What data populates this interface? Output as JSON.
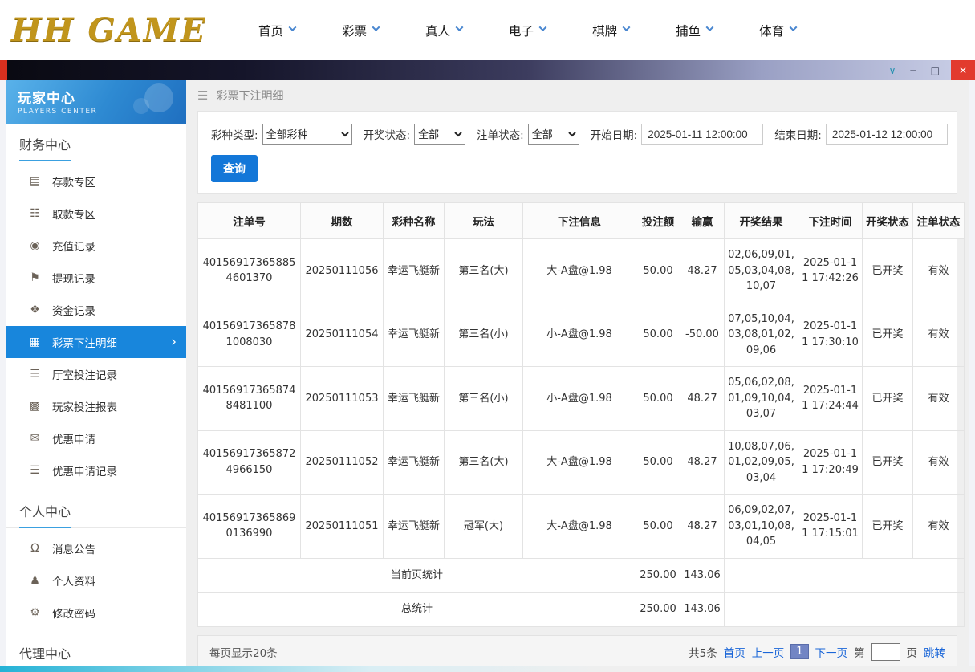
{
  "icons": {
    "menu": "☰",
    "window_chevron": "∨",
    "window_minimize": "─",
    "window_maximize": "□",
    "window_close": "✕",
    "active_arrow": "›"
  },
  "top_nav": {
    "logo": "HH GAME",
    "items": [
      "首页",
      "彩票",
      "真人",
      "电子",
      "棋牌",
      "捕鱼",
      "体育"
    ]
  },
  "sidebar": {
    "title": "玩家中心",
    "subtitle": "PLAYERS CENTER",
    "sections": [
      {
        "title": "财务中心",
        "items": [
          {
            "label": "存款专区",
            "glyph": "▤"
          },
          {
            "label": "取款专区",
            "glyph": "☷"
          },
          {
            "label": "充值记录",
            "glyph": "◉"
          },
          {
            "label": "提现记录",
            "glyph": "⚑"
          },
          {
            "label": "资金记录",
            "glyph": "❖"
          },
          {
            "label": "彩票下注明细",
            "glyph": "▦"
          },
          {
            "label": "厅室投注记录",
            "glyph": "☰"
          },
          {
            "label": "玩家投注报表",
            "glyph": "▩"
          },
          {
            "label": "优惠申请",
            "glyph": "✉"
          },
          {
            "label": "优惠申请记录",
            "glyph": "☰"
          }
        ]
      },
      {
        "title": "个人中心",
        "items": [
          {
            "label": "消息公告",
            "glyph": "Ω"
          },
          {
            "label": "个人资料",
            "glyph": "♟"
          },
          {
            "label": "修改密码",
            "glyph": "⚙"
          }
        ]
      },
      {
        "title": "代理中心",
        "items": []
      }
    ]
  },
  "breadcrumb": {
    "icon": "☰",
    "title": "彩票下注明细"
  },
  "filters": {
    "lottery_type_label": "彩种类型:",
    "lottery_type_value": "全部彩种",
    "draw_status_label": "开奖状态:",
    "draw_status_value": "全部",
    "order_status_label": "注单状态:",
    "order_status_value": "全部",
    "start_date_label": "开始日期:",
    "start_date_value": "2025-01-11 12:00:00",
    "end_date_label": "结束日期:",
    "end_date_value": "2025-01-12 12:00:00",
    "search_button": "查询"
  },
  "table": {
    "headers": [
      "注单号",
      "期数",
      "彩种名称",
      "玩法",
      "下注信息",
      "投注额",
      "输赢",
      "开奖结果",
      "下注时间",
      "开奖状态",
      "注单状态"
    ],
    "rows": [
      [
        "401569173658854601370",
        "20250111056",
        "幸运飞艇新",
        "第三名(大)",
        "大-A盘@1.98",
        "50.00",
        "48.27",
        "02,06,09,01,05,03,04,08,10,07",
        "2025-01-11 17:42:26",
        "已开奖",
        "有效"
      ],
      [
        "401569173658781008030",
        "20250111054",
        "幸运飞艇新",
        "第三名(小)",
        "小-A盘@1.98",
        "50.00",
        "-50.00",
        "07,05,10,04,03,08,01,02,09,06",
        "2025-01-11 17:30:10",
        "已开奖",
        "有效"
      ],
      [
        "401569173658748481100",
        "20250111053",
        "幸运飞艇新",
        "第三名(小)",
        "小-A盘@1.98",
        "50.00",
        "48.27",
        "05,06,02,08,01,09,10,04,03,07",
        "2025-01-11 17:24:44",
        "已开奖",
        "有效"
      ],
      [
        "401569173658724966150",
        "20250111052",
        "幸运飞艇新",
        "第三名(大)",
        "大-A盘@1.98",
        "50.00",
        "48.27",
        "10,08,07,06,01,02,09,05,03,04",
        "2025-01-11 17:20:49",
        "已开奖",
        "有效"
      ],
      [
        "401569173658690136990",
        "20250111051",
        "幸运飞艇新",
        "冠军(大)",
        "大-A盘@1.98",
        "50.00",
        "48.27",
        "06,09,02,07,03,01,10,08,04,05",
        "2025-01-11 17:15:01",
        "已开奖",
        "有效"
      ]
    ],
    "summary_rows": [
      {
        "label": "当前页统计",
        "bet": "250.00",
        "winloss": "143.06"
      },
      {
        "label": "总统计",
        "bet": "250.00",
        "winloss": "143.06"
      }
    ]
  },
  "pagination": {
    "page_size_text": "每页显示20条",
    "total_text": "共5条",
    "first_label": "首页",
    "prev_label": "上一页",
    "current_page": "1",
    "next_label": "下一页",
    "jump_prefix": "第",
    "jump_suffix": "页",
    "jump_label": "跳转"
  },
  "colors": {
    "accent_blue": "#1886dc",
    "link_blue": "#1a66d8",
    "logo_gold": "#c1951c",
    "close_red": "#e23b2e"
  }
}
